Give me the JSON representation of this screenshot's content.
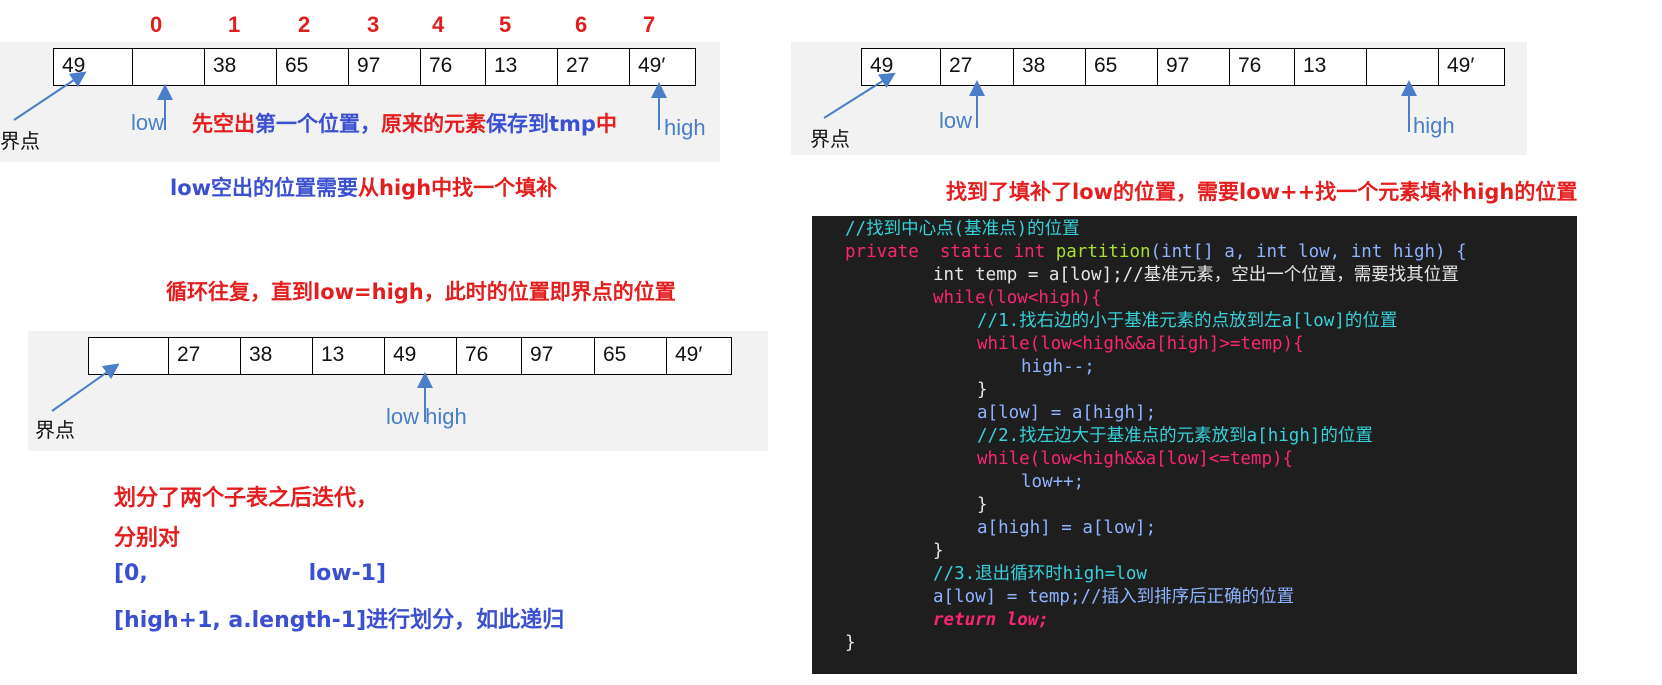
{
  "diagram1": {
    "indices": [
      "0",
      "1",
      "2",
      "3",
      "4",
      "5",
      "6",
      "7"
    ],
    "cells": [
      "49",
      "",
      "38",
      "65",
      "97",
      "76",
      "13",
      "27",
      "49′"
    ],
    "pivot_label": "界点",
    "low_label": "low",
    "high_label": "high",
    "inline_caption": {
      "part1": "先空出",
      "part2": "第一个位置，",
      "part3": "原来的元素",
      "part4": "保存到tmp",
      "part5": "中"
    },
    "caption": {
      "part1": "low空出的位置需要",
      "part2": "从high中找一个填补"
    }
  },
  "diagram2": {
    "cells": [
      "49",
      "27",
      "38",
      "65",
      "97",
      "76",
      "13",
      "",
      "49′"
    ],
    "pivot_label": "界点",
    "low_label": "low",
    "high_label": "high",
    "caption": "找到了填补了low的位置，需要low++找一个元素填补high的位置"
  },
  "diagram3": {
    "caption": "循环往复，直到low=high，此时的位置即界点的位置",
    "cells": [
      "",
      "27",
      "38",
      "13",
      "49",
      "76",
      "97",
      "65",
      "49′"
    ],
    "pivot_label": "界点",
    "lowhigh_label": "low high"
  },
  "steps": {
    "line1": "划分了两个子表之后迭代，",
    "line2": "分别对",
    "line3": "[0,                     low-1]",
    "line4": "[high+1, a.length-1]进行划分，如此递归"
  },
  "code": {
    "l1": "//找到中心点(基准点)的位置",
    "l2a": "private  static int ",
    "l2b": "partition",
    "l2c": "(int[] a, int low, int high) {",
    "l3": "int temp = a[low];//基准元素，空出一个位置，需要找其位置",
    "l4": "while(low<high){",
    "l5": "//1.找右边的小于基准元素的点放到左a[low]的位置",
    "l6": "while(low<high&&a[high]>=temp){",
    "l7": "high--;",
    "l8": "}",
    "l9": "a[low] = a[high];",
    "l10": "//2.找左边大于基准点的元素放到a[high]的位置",
    "l11": "while(low<high&&a[low]<=temp){",
    "l12": "low++;",
    "l13": "}",
    "l14": "a[high] = a[low];",
    "l15": "}",
    "l16": "//3.退出循环时high=low",
    "l17": "a[low] = temp;//插入到排序后正确的位置",
    "l18": "return low;",
    "l19": "}"
  }
}
